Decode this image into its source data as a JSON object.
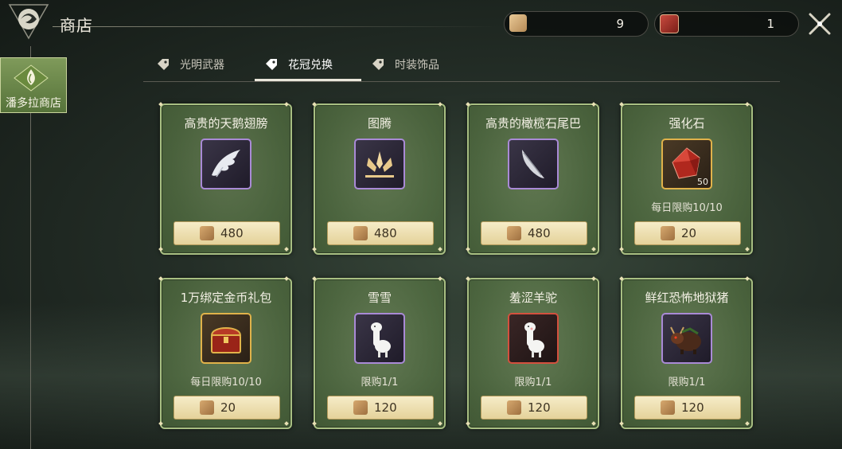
{
  "header": {
    "title": "商店",
    "logo_icon": "dragon-emblem-icon",
    "close_icon": "close-icon"
  },
  "currencies": [
    {
      "icon": "scroll-currency-icon",
      "value": "9"
    },
    {
      "icon": "red-ticket-currency-icon",
      "value": "1"
    }
  ],
  "left_nav": {
    "label": "潘多拉商店",
    "icon": "droplet-leaf-icon"
  },
  "tabs": [
    {
      "label": "光明武器",
      "icon": "tag-icon",
      "active": false
    },
    {
      "label": "花冠兑换",
      "icon": "tag-icon",
      "active": true
    },
    {
      "label": "时装饰品",
      "icon": "tag-icon",
      "active": false
    }
  ],
  "items": [
    {
      "name": "高贵的天鹅翅膀",
      "icon": "swan-wing-icon",
      "frame": "purple",
      "quantity": "",
      "limit": "",
      "price": "480"
    },
    {
      "name": "图腾",
      "icon": "totem-icon",
      "frame": "purple",
      "quantity": "",
      "limit": "",
      "price": "480"
    },
    {
      "name": "高贵的橄榄石尾巴",
      "icon": "tail-icon",
      "frame": "purple",
      "quantity": "",
      "limit": "",
      "price": "480"
    },
    {
      "name": "强化石",
      "icon": "enhance-stone-icon",
      "frame": "gold",
      "quantity": "50",
      "limit": "每日限购10/10",
      "price": "20"
    },
    {
      "name": "1万绑定金币礼包",
      "icon": "treasure-chest-icon",
      "frame": "gold",
      "quantity": "",
      "limit": "每日限购10/10",
      "price": "20"
    },
    {
      "name": "雪雪",
      "icon": "alpaca-icon",
      "frame": "purple",
      "quantity": "",
      "limit": "限购1/1",
      "price": "120"
    },
    {
      "name": "羞涩羊驼",
      "icon": "alpaca-icon",
      "frame": "red",
      "quantity": "",
      "limit": "限购1/1",
      "price": "120"
    },
    {
      "name": "鲜红恐怖地狱猪",
      "icon": "hell-boar-icon",
      "frame": "purple",
      "quantity": "",
      "limit": "限购1/1",
      "price": "120"
    }
  ],
  "price_currency_icon": "scroll-currency-icon",
  "colors": {
    "card_border": "#a8bf82",
    "buy_button": "#f0e3b4",
    "purple_frame": "#a98ad6",
    "gold_frame": "#e0b24a",
    "red_frame": "#d4503e"
  }
}
